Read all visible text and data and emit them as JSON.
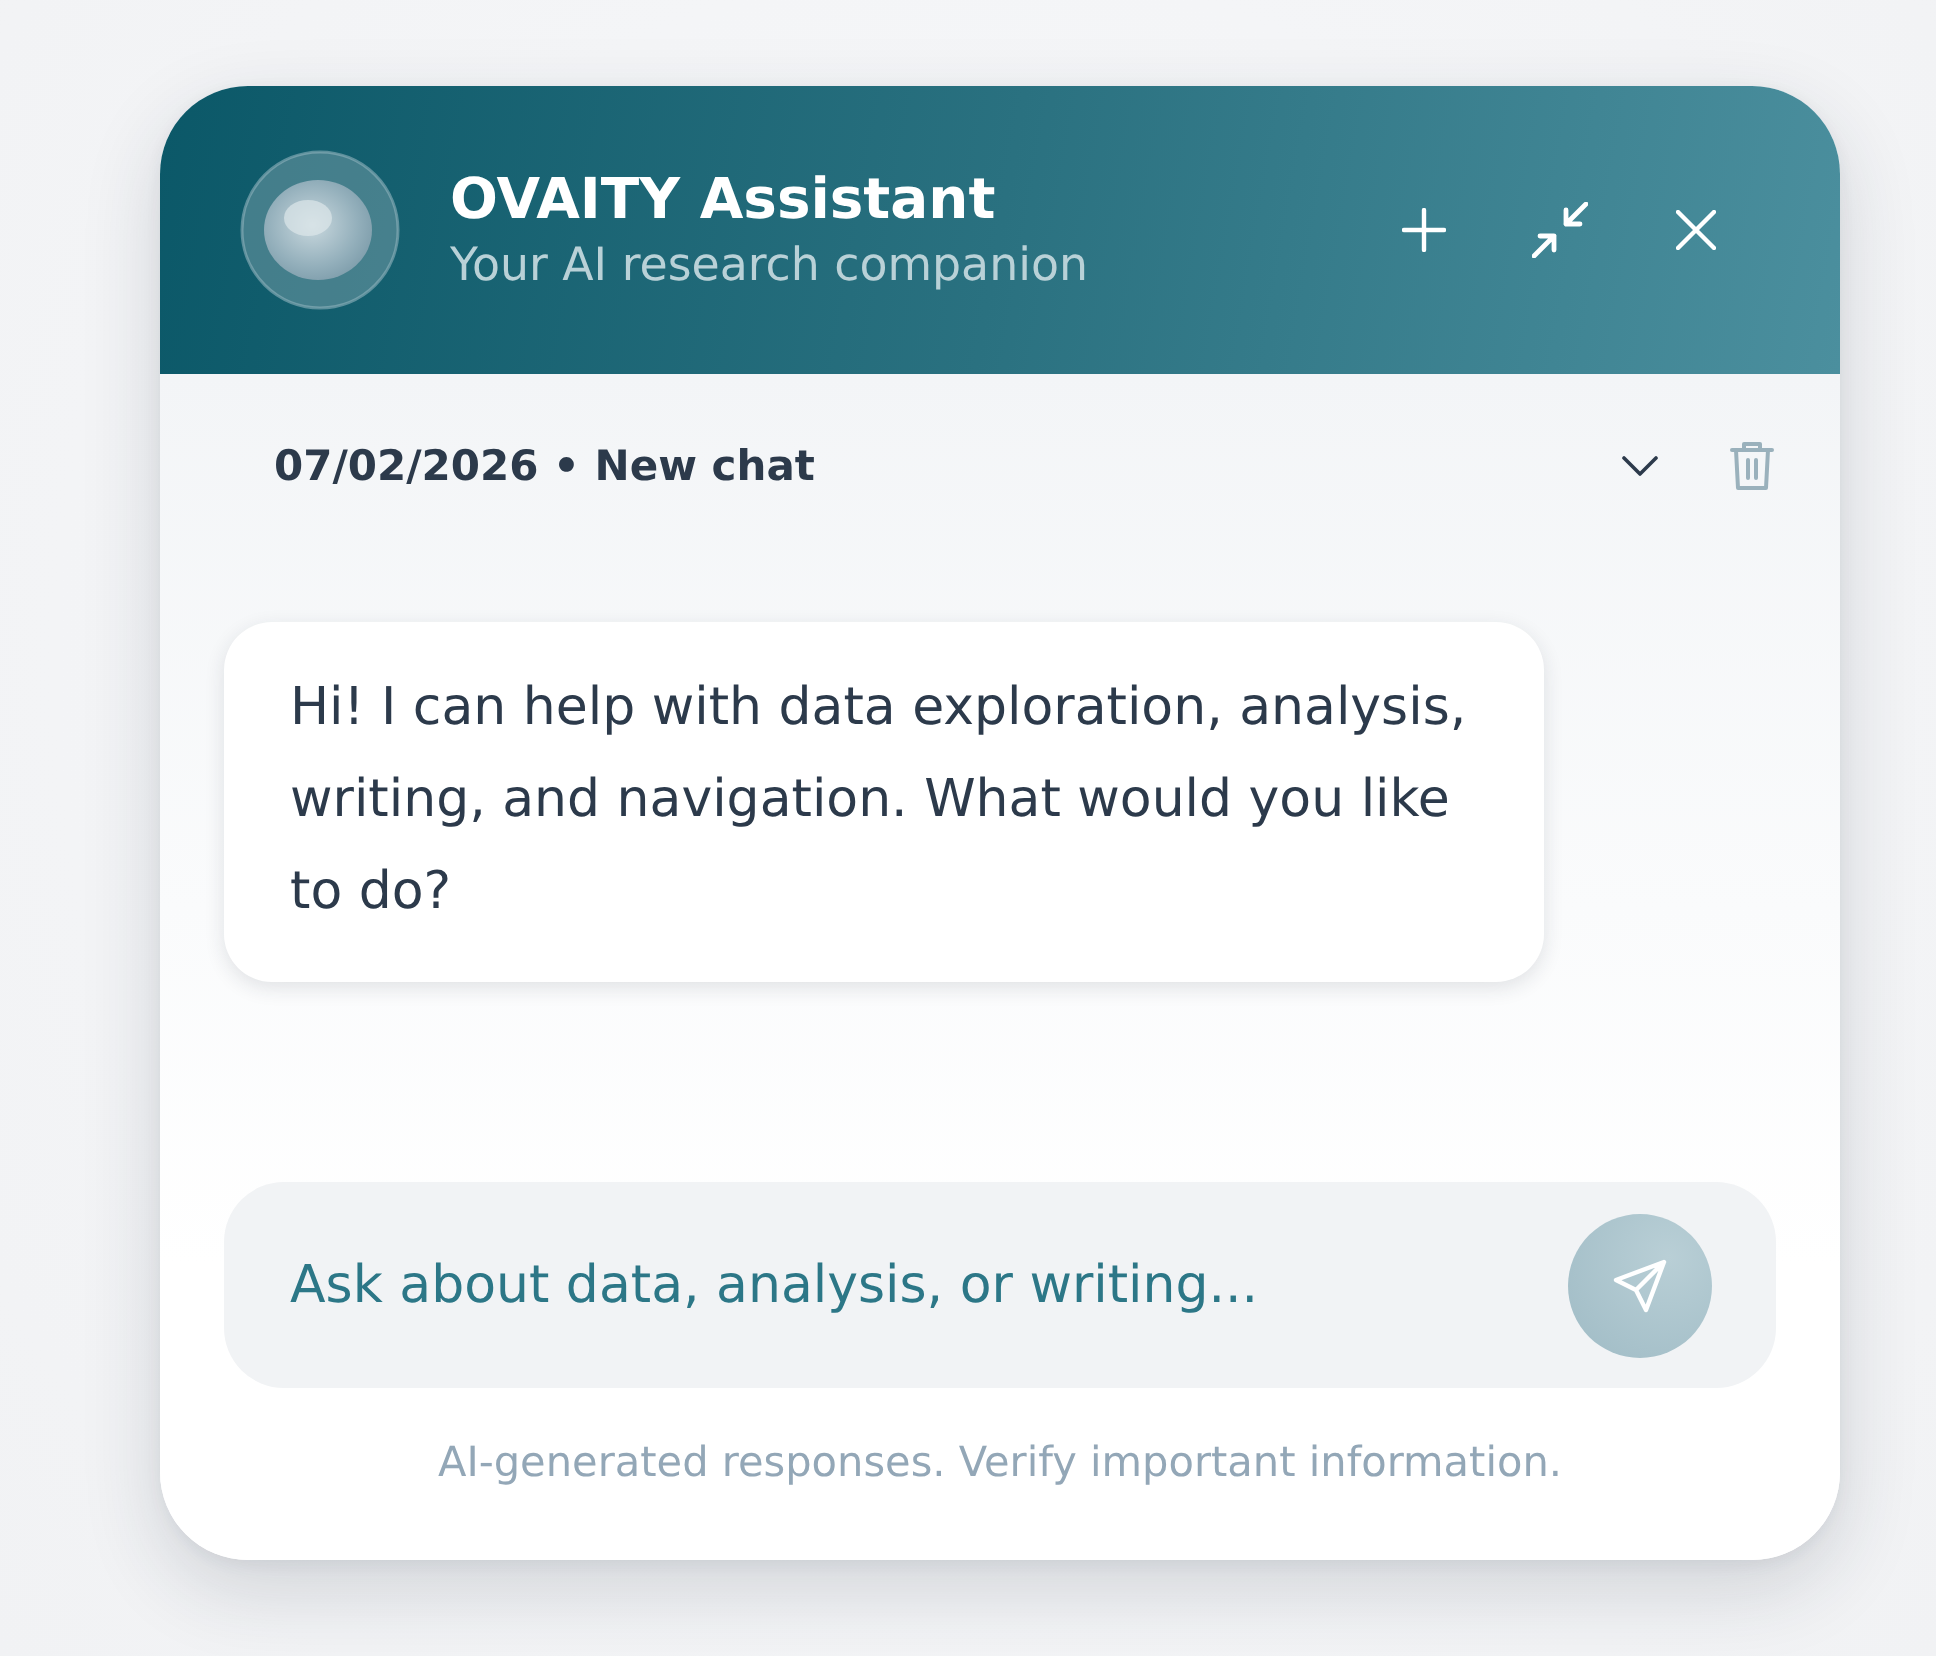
{
  "header": {
    "title": "OVAITY Assistant",
    "subtitle": "Your AI research companion",
    "actions": [
      {
        "kind": "new"
      },
      {
        "kind": "minimize"
      },
      {
        "kind": "close"
      }
    ]
  },
  "session": {
    "label": "07/02/2026 • New chat",
    "expanded": false
  },
  "messages": [
    {
      "kind": "assistant",
      "text": "Hi! I can help with data exploration, analysis, writing, and navigation. What would you like to do?"
    }
  ],
  "composer": {
    "placeholder": "Ask about data, analysis, or writing...",
    "send_disabled": true
  },
  "footer_note": "AI-generated responses. Verify important information."
}
